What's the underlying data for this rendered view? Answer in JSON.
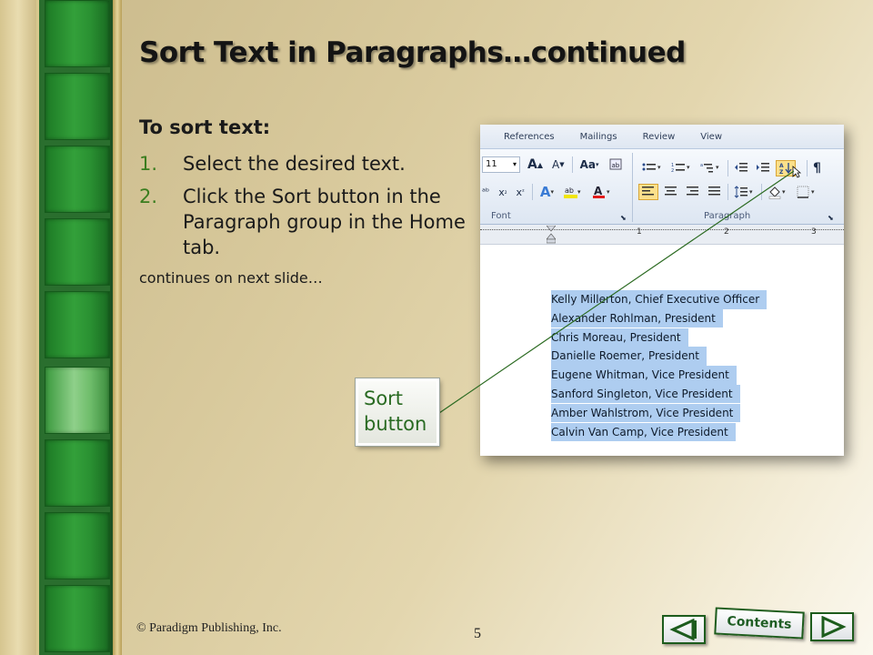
{
  "slide": {
    "title": "Sort Text in Paragraphs…continued",
    "intro": "To sort text:",
    "steps": [
      {
        "num": "1.",
        "text": "Select the desired text."
      },
      {
        "num": "2.",
        "text": "Click the Sort button in the Paragraph group in the Home tab."
      }
    ],
    "continues": "continues on next slide…"
  },
  "word": {
    "tabs": [
      "References",
      "Mailings",
      "Review",
      "View"
    ],
    "font_size": "11",
    "group_labels": {
      "font": "Font",
      "paragraph": "Paragraph"
    },
    "ruler_numbers": [
      "1",
      "2",
      "3"
    ],
    "names": [
      "Kelly Millerton, Chief Executive Officer",
      "Alexander Rohlman, President",
      "Chris Moreau, President",
      "Danielle Roemer, President",
      "Eugene Whitman, Vice President",
      "Sanford Singleton, Vice President",
      "Amber Wahlstrom, Vice President",
      "Calvin Van Camp, Vice President"
    ]
  },
  "callout": {
    "label": "Sort button"
  },
  "footer": {
    "copyright": "© Paradigm Publishing, Inc.",
    "page_number": "5",
    "contents_label": "Contents"
  },
  "colors": {
    "title_text": "#141414",
    "green_accent": "#3a7d1f",
    "selection": "#aecdf0"
  }
}
